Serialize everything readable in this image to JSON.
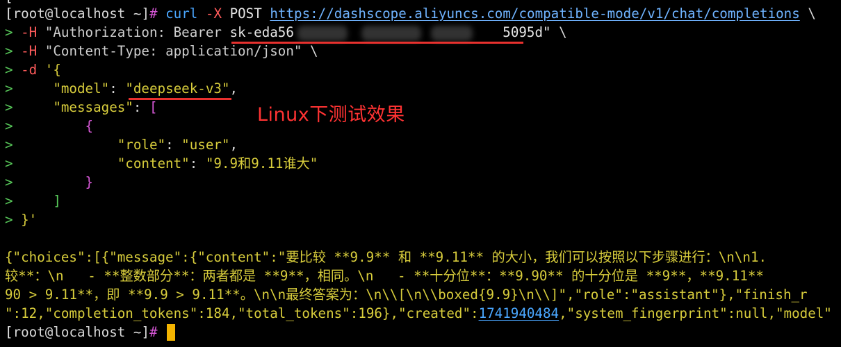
{
  "terminal": {
    "prompt_user": "root",
    "prompt_host": "localhost",
    "prompt_dir": "~",
    "prompt_char": "#",
    "command": "curl",
    "flag_X": "-X",
    "method": "POST",
    "url": "https://dashscope.aliyuncs.com/compatible-mode/v1/chat/completions",
    "continuation": "\\",
    "cont_prompt": ">",
    "flag_H": "-H",
    "auth_header_prefix": "\"Authorization: Bearer ",
    "key_start": "sk-eda56",
    "key_end": "5095d\"",
    "content_type_header": "\"Content-Type: application/json\"",
    "flag_d": "-d",
    "body_open": "'{",
    "model_key": "\"model\"",
    "model_value": "\"deepseek-v3\"",
    "messages_key": "\"messages\"",
    "role_key": "\"role\"",
    "role_value": "\"user\"",
    "content_key": "\"content\"",
    "content_value": "\"9.9和9.11谁大\"",
    "body_close": "}'",
    "response_line1_a": "{\"choices\":[{\"message\":{\"content\":\"要比较 **9.9** 和 **9.11** 的大小，我们可以按照以下步骤进行：\\n\\n1.",
    "response_line2": "较**：\\n   - **整数部分**：两者都是 **9**，相同。\\n   - **十分位**：**9.90** 的十分位是 **9**，**9.11**",
    "response_line3": "90 > 9.11**，即 **9.9 > 9.11**。\\n\\n最终答案为：\\n\\\\[\\n\\\\boxed{9.9}\\n\\\\]\",\"role\":\"assistant\"},\"finish_r",
    "response_line4_a": "\":12,\"completion_tokens\":184,\"total_tokens\":196},\"created\":",
    "created_ts": "1741940484",
    "response_line4_b": ",\"system_fingerprint\":null,\"model\""
  },
  "annotation": {
    "text": "Linux下测试效果",
    "color": "#ff3333"
  },
  "colors": {
    "background": "#000000",
    "prompt_green": "#58c95a",
    "string_yellow": "#d8cd3c",
    "brace_magenta": "#d657d6",
    "url_blue": "#6fb3ff",
    "cursor": "#f4b400",
    "annotation_red": "#ff3333"
  }
}
